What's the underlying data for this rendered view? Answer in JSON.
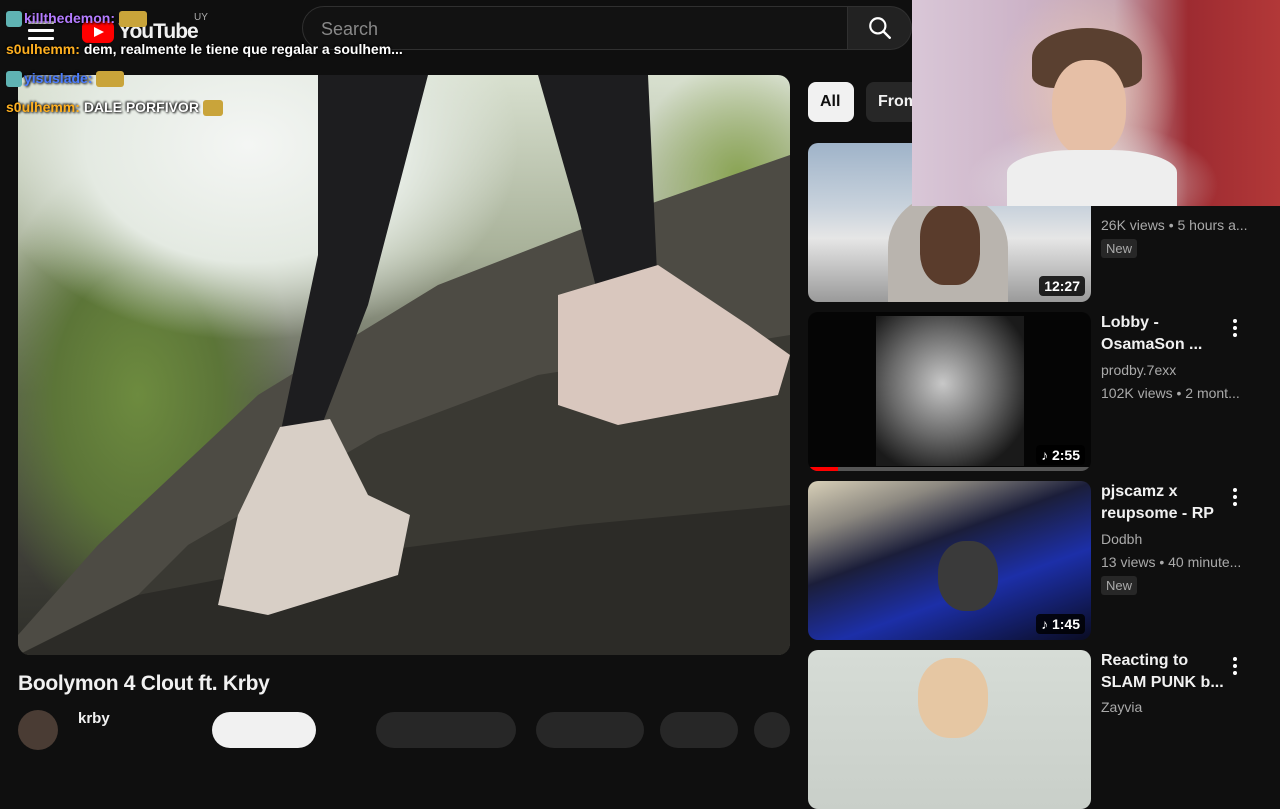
{
  "header": {
    "logo_text": "YouTube",
    "country_code": "UY",
    "search_placeholder": "Search"
  },
  "video": {
    "title": "Boolymon 4 Clout ft. Krby",
    "channel": "krby"
  },
  "chips": [
    "All",
    "From"
  ],
  "recommendations": [
    {
      "title": "",
      "channel": "",
      "meta": "26K views • 5 hours a...",
      "badge": "New",
      "duration": "12:27"
    },
    {
      "title": "Lobby - OsamaSon ...",
      "channel": "prodby.7exx",
      "meta": "102K views • 2 mont...",
      "badge": "",
      "duration": "2:55"
    },
    {
      "title": "pjscamz x reupsome - RP",
      "channel": "Dodbh",
      "meta": "13 views • 40 minute...",
      "badge": "New",
      "duration": "1:45"
    },
    {
      "title": "Reacting to SLAM PUNK b...",
      "channel": "Zayvia",
      "meta": "",
      "badge": "",
      "duration": ""
    }
  ],
  "chat": [
    {
      "user": "killthedemon:",
      "message": "",
      "color": "#b47cff"
    },
    {
      "user": "s0ulhemm:",
      "message": "dem, realmente le tiene que regalar a soulhem...",
      "color": "#ffb020"
    },
    {
      "user": "yisuslade:",
      "message": "",
      "color": "#4a7cff"
    },
    {
      "user": "s0ulhemm:",
      "message": "DALE PORFIVOR",
      "color": "#ffb020"
    }
  ],
  "colors": {
    "background": "#0f0f0f",
    "accent_red": "#ff0000",
    "text_primary": "#f1f1f1",
    "text_secondary": "#aaaaaa"
  }
}
